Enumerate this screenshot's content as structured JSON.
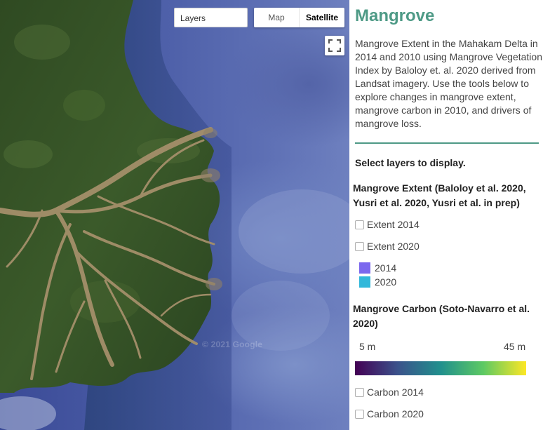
{
  "map": {
    "layers_label": "Layers",
    "map_types": [
      "Map",
      "Satellite"
    ],
    "active_map_type": "Satellite",
    "watermark": "© 2021 Google"
  },
  "panel": {
    "title": "Mangrove",
    "title_color": "#4e9a86",
    "description": "Mangrove Extent in the Mahakam Delta in 2014 and 2010 using Mangrove Vegetation Index by Baloloy et. al. 2020 derived from Landsat imagery. Use the tools below to explore changes in mangrove extent, mangrove carbon in 2010, and drivers of mangrove loss.",
    "select_prompt": "Select layers to display.",
    "extent_section": {
      "heading": "Mangrove Extent (Baloloy et al. 2020, Yusri et al. 2020, Yusri et al. in prep)",
      "checkboxes": [
        {
          "label": "Extent 2014",
          "checked": false
        },
        {
          "label": "Extent 2020",
          "checked": false
        }
      ],
      "legend": [
        {
          "label": "2014",
          "color": "#7b68ee"
        },
        {
          "label": "2020",
          "color": "#32b8da"
        }
      ]
    },
    "carbon_section": {
      "heading": "Mangrove Carbon (Soto-Navarro et al. 2020)",
      "scale_min": "5 m",
      "scale_max": "45 m",
      "checkboxes": [
        {
          "label": "Carbon 2014",
          "checked": false
        },
        {
          "label": "Carbon 2020",
          "checked": false
        }
      ]
    }
  }
}
